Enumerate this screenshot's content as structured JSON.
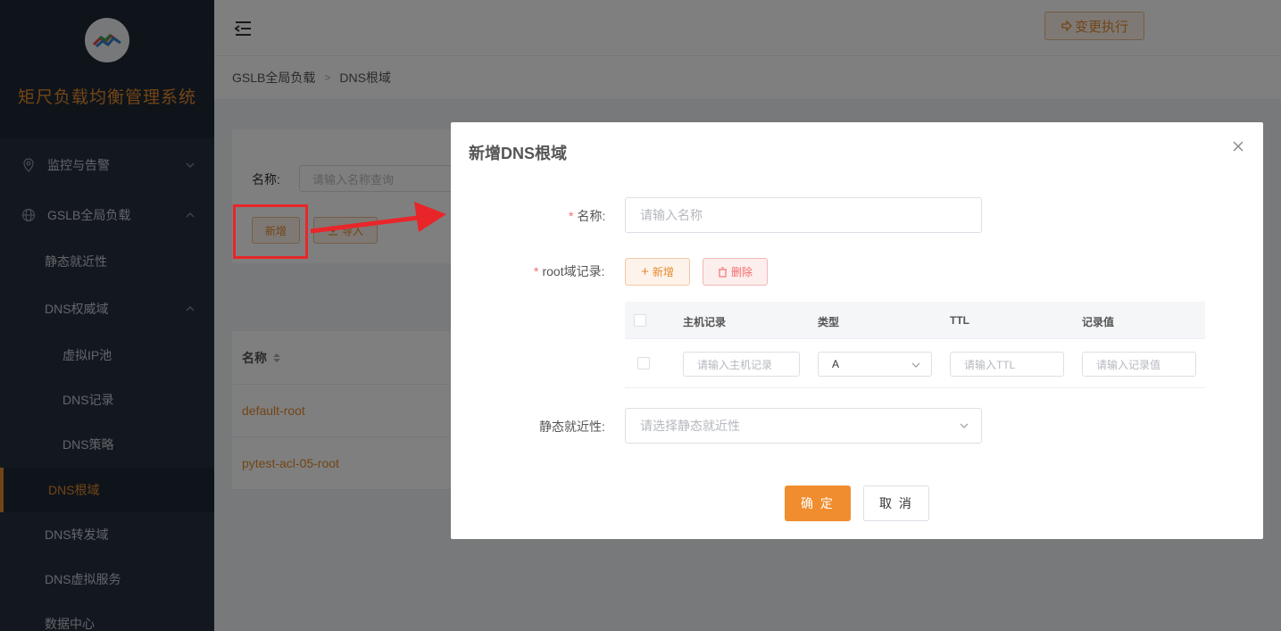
{
  "brand": {
    "title": "矩尺负载均衡管理系统"
  },
  "sidebar": {
    "items": [
      {
        "label": "监控与告警"
      },
      {
        "label": "GSLB全局负载"
      },
      {
        "label": "静态就近性"
      },
      {
        "label": "DNS权威域"
      },
      {
        "label": "虚拟IP池"
      },
      {
        "label": "DNS记录"
      },
      {
        "label": "DNS策略"
      },
      {
        "label": "DNS根域"
      },
      {
        "label": "DNS转发域"
      },
      {
        "label": "DNS虚拟服务"
      },
      {
        "label": "数据中心"
      }
    ],
    "active_color": "#e58a2e"
  },
  "header": {
    "exec_label": "变更执行"
  },
  "breadcrumb": {
    "root": "GSLB全局负载",
    "current": "DNS根域"
  },
  "search": {
    "label": "名称:",
    "placeholder": "请输入名称查询",
    "add_label": "新增",
    "import_label": "导入"
  },
  "table": {
    "col_name": "名称",
    "rows": [
      {
        "name": "default-root"
      },
      {
        "name": "pytest-acl-05-root"
      }
    ]
  },
  "modal": {
    "title": "新增DNS根域",
    "name_label": "名称:",
    "name_placeholder": "请输入名称",
    "root_label": "root域记录:",
    "add_label": "新增",
    "delete_label": "删除",
    "columns": {
      "host": "主机记录",
      "type": "类型",
      "ttl": "TTL",
      "value": "记录值"
    },
    "row": {
      "host_placeholder": "请输入主机记录",
      "type_value": "A",
      "ttl_placeholder": "请输入TTL",
      "value_placeholder": "请输入记录值"
    },
    "static_label": "静态就近性:",
    "static_placeholder": "请选择静态就近性",
    "ok_label": "确 定",
    "cancel_label": "取 消"
  },
  "colors": {
    "accent": "#e58a2e",
    "danger": "#f56c6c",
    "annotation": "#e8262a"
  }
}
